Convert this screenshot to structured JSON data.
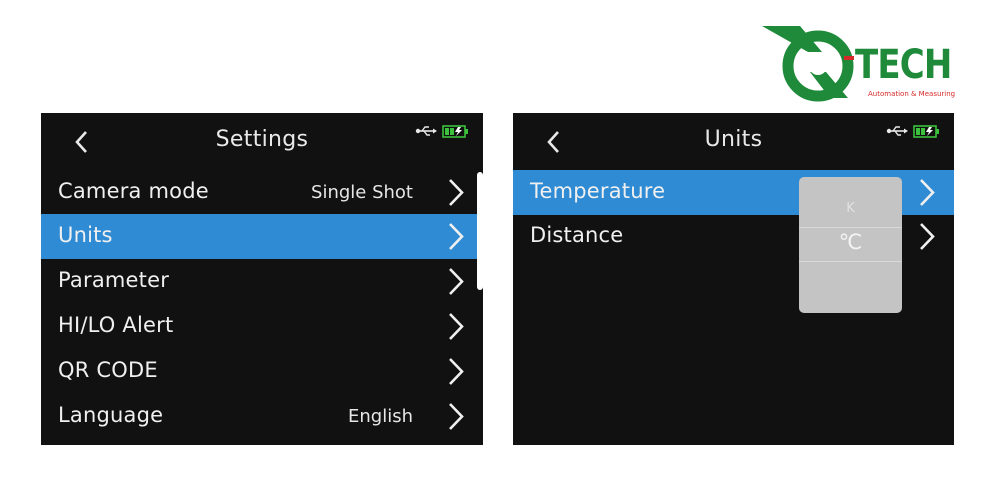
{
  "logo": {
    "text": "TECH",
    "tagline": "Automation & Measuring"
  },
  "settings": {
    "title": "Settings",
    "items": [
      {
        "label": "Camera mode",
        "value": "Single Shot"
      },
      {
        "label": "Units",
        "value": ""
      },
      {
        "label": "Parameter",
        "value": ""
      },
      {
        "label": "HI/LO Alert",
        "value": ""
      },
      {
        "label": "QR CODE",
        "value": ""
      },
      {
        "label": "Language",
        "value": "English"
      }
    ],
    "selected_index": 1
  },
  "units": {
    "title": "Units",
    "items": [
      {
        "label": "Temperature"
      },
      {
        "label": "Distance"
      }
    ],
    "selected_index": 0,
    "dropdown": {
      "options": [
        "K",
        "℃"
      ],
      "selected": "℃"
    }
  },
  "colors": {
    "selection": "#2f8bd3",
    "screen_bg": "#111111",
    "battery": "#3cc13c",
    "brand_green": "#1e8a3a",
    "brand_red": "#d62a2a"
  },
  "icons": {
    "back": "chevron-left-icon",
    "next": "chevron-right-icon",
    "usb": "usb-icon",
    "battery": "battery-charging-icon"
  }
}
